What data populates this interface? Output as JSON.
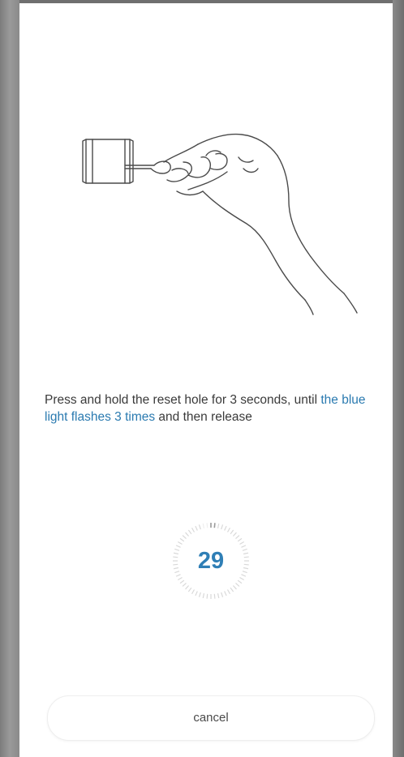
{
  "instruction": {
    "text_before": "Press and hold the reset hole for 3 seconds, until ",
    "highlight": "the blue light flashes 3 times",
    "text_after": " and then release"
  },
  "timer": {
    "value": "29",
    "remaining_fraction": 0.97
  },
  "actions": {
    "cancel_label": "cancel"
  },
  "colors": {
    "accent": "#2f7fb6",
    "text": "#3a3a3a",
    "background": "#ffffff"
  },
  "icons": {
    "illustration": "hand-pressing-reset-hole-icon"
  }
}
